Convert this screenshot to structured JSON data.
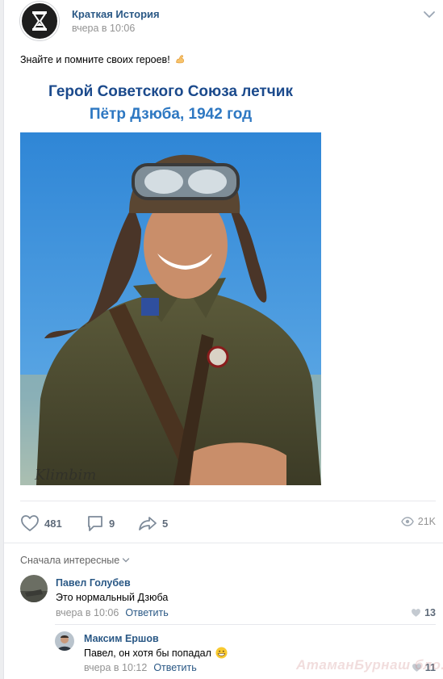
{
  "post": {
    "group_name": "Краткая История",
    "time": "вчера в 10:06",
    "text": "Знайте и помните своих героев!",
    "text_emoji_icon": "flexed-biceps-icon",
    "caption_line1": "Герой Советского Союза летчик",
    "caption_line2": "Пётр Дзюба, 1942 год",
    "photo_signature": "Klimbim",
    "colors": {
      "link": "#2a5885",
      "caption_dark": "#1b4a8c",
      "caption_light": "#2e78c2",
      "sky": "#3d8fd4"
    }
  },
  "actions": {
    "likes": "481",
    "comments": "9",
    "shares": "5",
    "views": "21K"
  },
  "comments_header": {
    "sort_label": "Сначала интересные"
  },
  "comments": [
    {
      "author": "Павел Голубев",
      "text": "Это нормальный Дзюба",
      "time": "вчера в 10:06",
      "reply_label": "Ответить",
      "likes": "13"
    },
    {
      "author": "Максим Ершов",
      "text": "Павел, он хотя бы попадал",
      "text_emoji_icon": "grinning-face-icon",
      "time": "вчера в 10:12",
      "reply_label": "Ответить",
      "likes": "11"
    }
  ],
  "watermark": "АтаманБурнаш бло.. Ф"
}
